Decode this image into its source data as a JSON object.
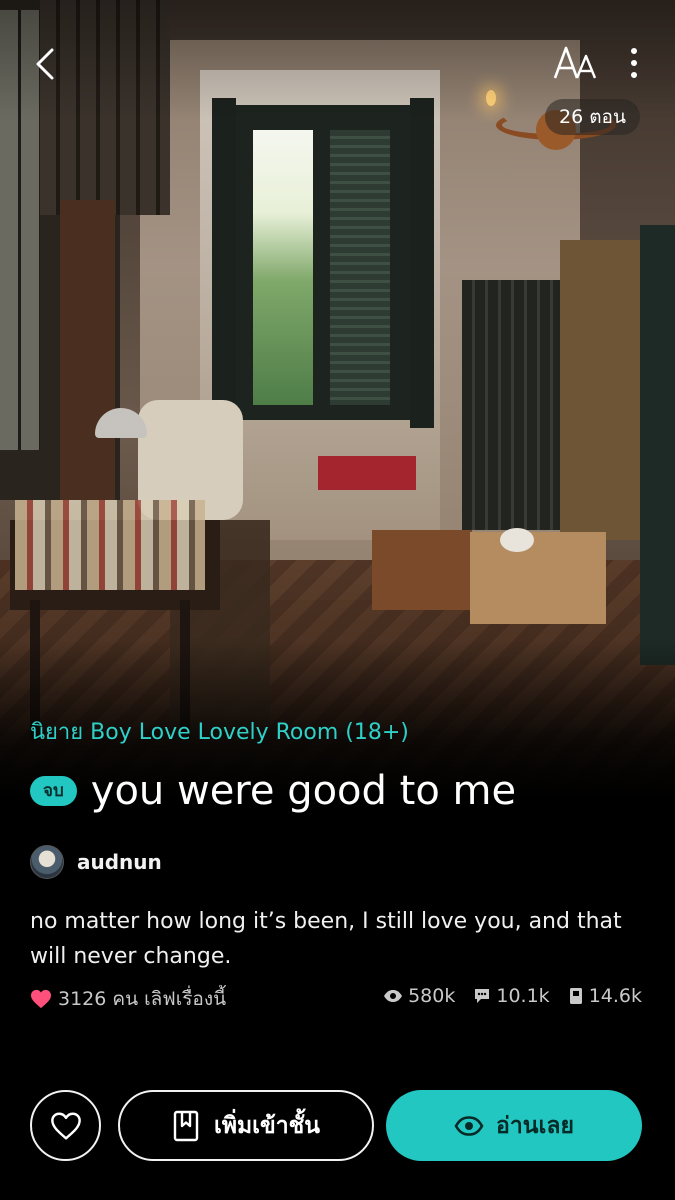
{
  "header": {
    "back_icon": "chevron-left-icon",
    "font_size_label": "AA",
    "more_icon": "vertical-dots-icon",
    "episode_count": "26 ตอน"
  },
  "story": {
    "category": "นิยาย Boy Love Lovely Room (18+)",
    "status": "จบ",
    "title": "you were good to me",
    "author": "audnun",
    "description": "no matter how long it’s been, I still love you, and that will never change.",
    "likes": "3126 คน เลิฟเรื่องนี้",
    "views": "580k",
    "comments": "10.1k",
    "library_adds": "14.6k"
  },
  "actions": {
    "favorite_icon": "heart-outline-icon",
    "add_library_label": "เพิ่มเข้าชั้น",
    "read_now_label": "อ่านเลย"
  },
  "colors": {
    "accent": "#23c7c1",
    "category_text": "#2ed0c8",
    "heart": "#ff4f7b",
    "background": "#000000"
  }
}
